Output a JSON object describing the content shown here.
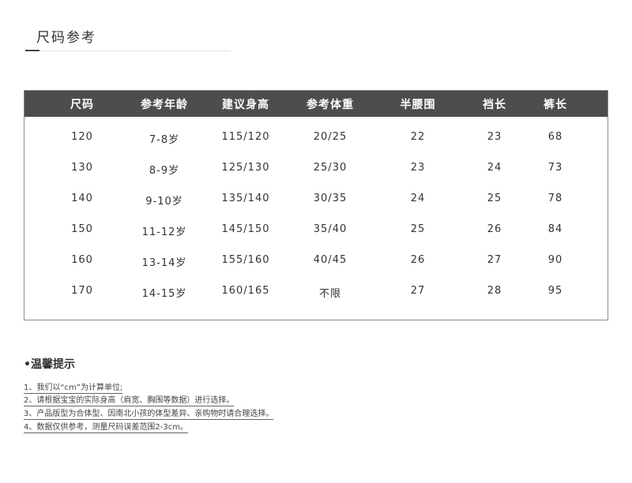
{
  "title": "尺码参考",
  "table": {
    "headers": [
      "尺码",
      "参考年龄",
      "建议身高",
      "参考体重",
      "半腰围",
      "裆长",
      "裤长"
    ],
    "rows": [
      [
        "120",
        "7-8岁",
        "115/120",
        "20/25",
        "22",
        "23",
        "68"
      ],
      [
        "130",
        "8-9岁",
        "125/130",
        "25/30",
        "23",
        "24",
        "73"
      ],
      [
        "140",
        "9-10岁",
        "135/140",
        "30/35",
        "24",
        "25",
        "78"
      ],
      [
        "150",
        "11-12岁",
        "145/150",
        "35/40",
        "25",
        "26",
        "84"
      ],
      [
        "160",
        "13-14岁",
        "155/160",
        "40/45",
        "26",
        "27",
        "90"
      ],
      [
        "170",
        "14-15岁",
        "160/165",
        "不限",
        "27",
        "28",
        "95"
      ]
    ]
  },
  "tips": {
    "title": "•温馨提示",
    "items": [
      "1、我们以“cm”为计算单位;",
      "2、请根据宝宝的实际身高（肩宽、胸围等数据）进行选择。",
      "3、产品版型为合体型、因南北小孩的体型差异、亲购物时请合理选择。",
      "4、数据仅供参考，测量尺码误差范围2-3cm。"
    ]
  }
}
